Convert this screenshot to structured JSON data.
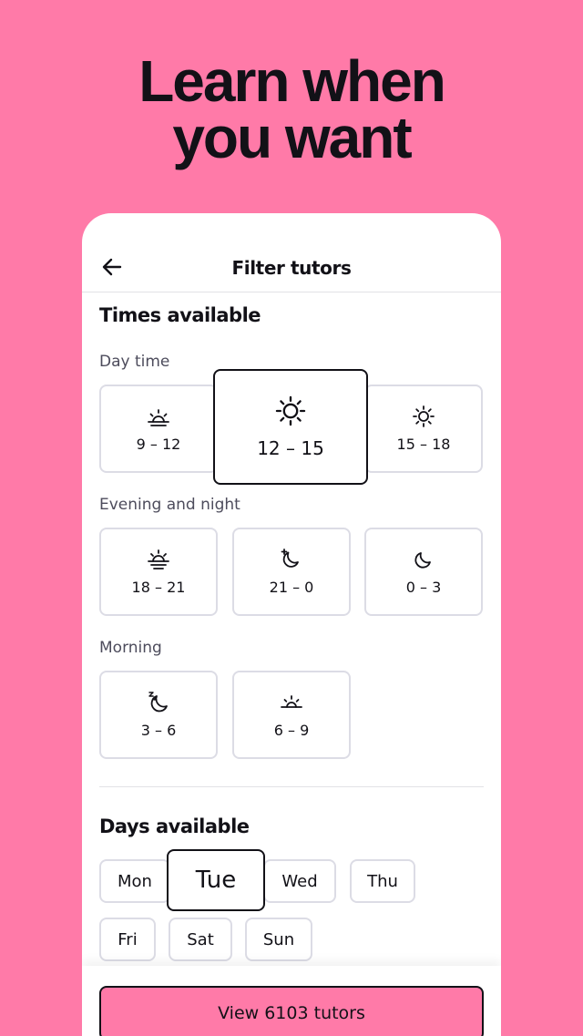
{
  "headline": {
    "line1": "Learn when",
    "line2": "you want"
  },
  "topbar": {
    "title": "Filter tutors",
    "back_icon": "arrow-left-icon"
  },
  "times": {
    "title": "Times available",
    "groups": [
      {
        "label": "Day time",
        "slots": [
          {
            "label": "9 – 12",
            "icon": "sunrise-icon",
            "selected": false
          },
          {
            "label": "12 – 15",
            "icon": "sun-icon",
            "selected": true
          },
          {
            "label": "15 – 18",
            "icon": "sun-small-icon",
            "selected": false
          }
        ]
      },
      {
        "label": "Evening and night",
        "slots": [
          {
            "label": "18 – 21",
            "icon": "sunset-icon",
            "selected": false
          },
          {
            "label": "21 – 0",
            "icon": "moon-star-icon",
            "selected": false
          },
          {
            "label": "0 – 3",
            "icon": "moon-icon",
            "selected": false
          }
        ]
      },
      {
        "label": "Morning",
        "slots": [
          {
            "label": "3 – 6",
            "icon": "moon-zzz-icon",
            "selected": false
          },
          {
            "label": "6 – 9",
            "icon": "dawn-icon",
            "selected": false
          }
        ]
      }
    ]
  },
  "days": {
    "title": "Days available",
    "items": [
      {
        "label": "Mon",
        "selected": false
      },
      {
        "label": "Tue",
        "selected": true
      },
      {
        "label": "Wed",
        "selected": false
      },
      {
        "label": "Thu",
        "selected": false
      },
      {
        "label": "Fri",
        "selected": false
      },
      {
        "label": "Sat",
        "selected": false
      },
      {
        "label": "Sun",
        "selected": false
      }
    ]
  },
  "cta": {
    "label": "View 6103 tutors"
  },
  "colors": {
    "background": "#ff7aa8",
    "text": "#121117",
    "border": "#dcdce5",
    "muted": "#4d4c5c"
  }
}
